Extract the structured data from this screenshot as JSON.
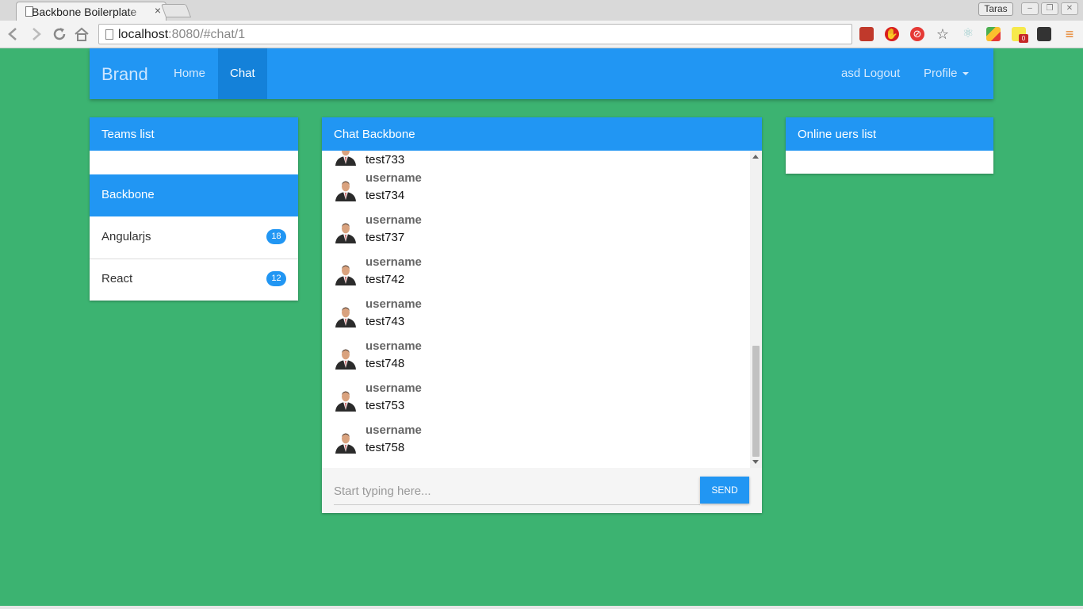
{
  "browser": {
    "tab_title": "Backbone Boilerplate",
    "tab_close": "×",
    "profile_name": "Taras",
    "url_host": "localhost",
    "url_rest": ":8080/#chat/1",
    "window_buttons": [
      "–",
      "❐",
      "✕"
    ],
    "extension_icons": [
      "book-icon",
      "adblock-icon",
      "stop-icon",
      "star-icon",
      "react-devtools-icon",
      "drive-icon",
      "sticky-notes-icon",
      "tampermonkey-icon",
      "menu-icon"
    ],
    "notes_badge": "0"
  },
  "navbar": {
    "brand": "Brand",
    "links": [
      {
        "label": "Home"
      },
      {
        "label": "Chat"
      }
    ],
    "logout": "asd Logout",
    "profile": "Profile"
  },
  "teams": {
    "title": "Teams list",
    "items": [
      {
        "label": "Backbone",
        "count": ""
      },
      {
        "label": "Angularjs",
        "count": "18"
      },
      {
        "label": "React",
        "count": "12"
      }
    ]
  },
  "chat": {
    "title": "Chat Backbone",
    "partial_message": "test733",
    "messages": [
      {
        "user": "username",
        "text": "test734"
      },
      {
        "user": "username",
        "text": "test737"
      },
      {
        "user": "username",
        "text": "test742"
      },
      {
        "user": "username",
        "text": "test743"
      },
      {
        "user": "username",
        "text": "test748"
      },
      {
        "user": "username",
        "text": "test753"
      },
      {
        "user": "username",
        "text": "test758"
      }
    ],
    "input_placeholder": "Start typing here...",
    "send_label": "SEND"
  },
  "online": {
    "title": "Online uers list"
  },
  "colors": {
    "background": "#3cb371",
    "primary": "#2196f3",
    "active_nav": "#1481d9"
  }
}
